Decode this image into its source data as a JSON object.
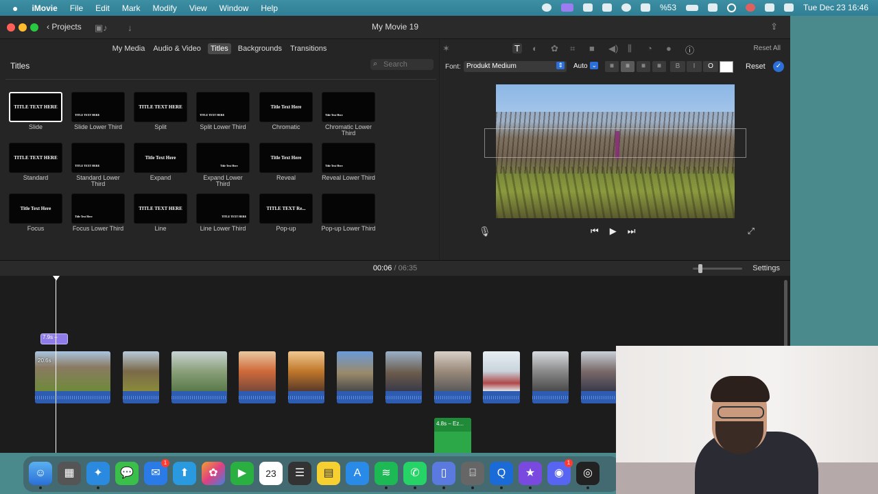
{
  "menubar": {
    "apple": "",
    "app_name": "iMovie",
    "menus": [
      "File",
      "Edit",
      "Mark",
      "Modify",
      "View",
      "Window",
      "Help"
    ],
    "battery": "%53",
    "datetime": "Tue Dec 23  16:46"
  },
  "window": {
    "projects_label": "Projects",
    "title": "My Movie 19"
  },
  "browser": {
    "tabs": [
      "My Media",
      "Audio & Video",
      "Titles",
      "Backgrounds",
      "Transitions"
    ],
    "selected_tab": "Titles",
    "section_title": "Titles",
    "search_placeholder": "Search",
    "titles": [
      {
        "label": "Slide",
        "thumb": "TITLE TEXT HERE"
      },
      {
        "label": "Slide Lower Third",
        "thumb": ""
      },
      {
        "label": "Split",
        "thumb": "TITLE TEXT HERE"
      },
      {
        "label": "Split Lower Third",
        "thumb": ""
      },
      {
        "label": "Chromatic",
        "thumb": "Title Text Here"
      },
      {
        "label": "Chromatic Lower Third",
        "thumb": ""
      },
      {
        "label": "Standard",
        "thumb": "TITLE TEXT HERE"
      },
      {
        "label": "Standard Lower Third",
        "thumb": ""
      },
      {
        "label": "Expand",
        "thumb": "Title Text Here"
      },
      {
        "label": "Expand Lower Third",
        "thumb": ""
      },
      {
        "label": "Reveal",
        "thumb": "Title Text Here"
      },
      {
        "label": "Reveal Lower Third",
        "thumb": ""
      },
      {
        "label": "Focus",
        "thumb": "Title Text Here"
      },
      {
        "label": "Focus Lower Third",
        "thumb": ""
      },
      {
        "label": "Line",
        "thumb": "TITLE TEXT HERE"
      },
      {
        "label": "Line Lower Third",
        "thumb": ""
      },
      {
        "label": "Pop-up",
        "thumb": "TITLE TEXT Re..."
      },
      {
        "label": "Pop-up Lower Third",
        "thumb": ""
      }
    ]
  },
  "viewer": {
    "reset_all": "Reset All",
    "font_label": "Font:",
    "font_value": "Produkt Medium",
    "size_value": "Auto",
    "style_bold": "B",
    "style_italic": "I",
    "style_outline": "O",
    "text_color": "#ffffff",
    "reset": "Reset"
  },
  "timeline": {
    "current_time": "00:06",
    "separator": "/",
    "total_time": "06:35",
    "settings": "Settings",
    "title_clip_label": "7.9s –",
    "first_clip_duration": "20.6s",
    "audio_clip_label": "4.8s – Ez..."
  },
  "dock": {
    "calendar_day": "23",
    "mail_badge": "1",
    "discord_badge": "1"
  }
}
